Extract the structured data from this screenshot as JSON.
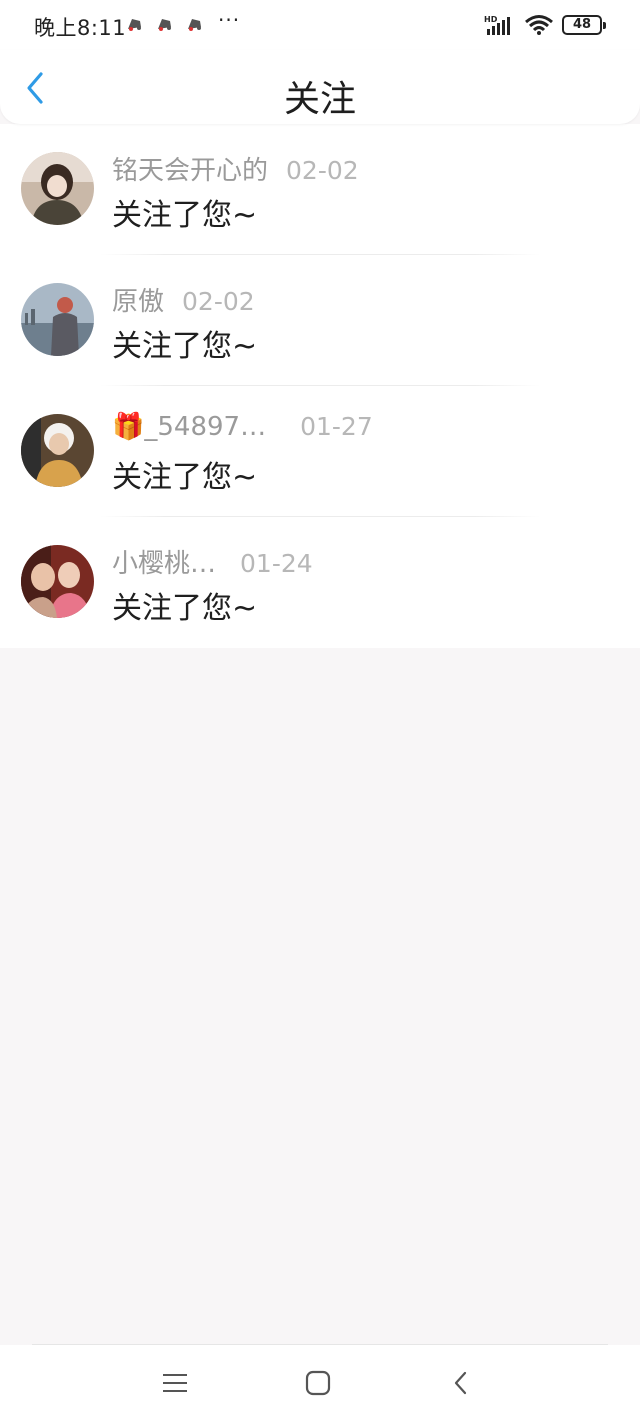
{
  "status_bar": {
    "time": "晚上8:11",
    "more": "···",
    "battery": "48",
    "network_label": "HD",
    "notification_icons": [
      "app-notification-icon",
      "app-notification-icon",
      "app-notification-icon"
    ]
  },
  "header": {
    "title": "关注",
    "back_icon": "chevron-left-icon",
    "accent_color": "#2f9be6"
  },
  "list": {
    "items": [
      {
        "name": "铭天会开心的",
        "date": "02-02",
        "message": "关注了您~",
        "avatar": "avatar-icon"
      },
      {
        "name": "原傲",
        "date": "02-02",
        "message": "关注了您~",
        "avatar": "avatar-icon"
      },
      {
        "name": "_54897…",
        "name_emoji": "🎁",
        "date": "01-27",
        "message": "关注了您~",
        "avatar": "avatar-icon"
      },
      {
        "name": "小樱桃…",
        "date": "01-24",
        "message": "关注了您~",
        "avatar": "avatar-icon"
      }
    ]
  },
  "nav_bar": {
    "icons": [
      "menu-icon",
      "home-square-icon",
      "back-icon"
    ]
  }
}
